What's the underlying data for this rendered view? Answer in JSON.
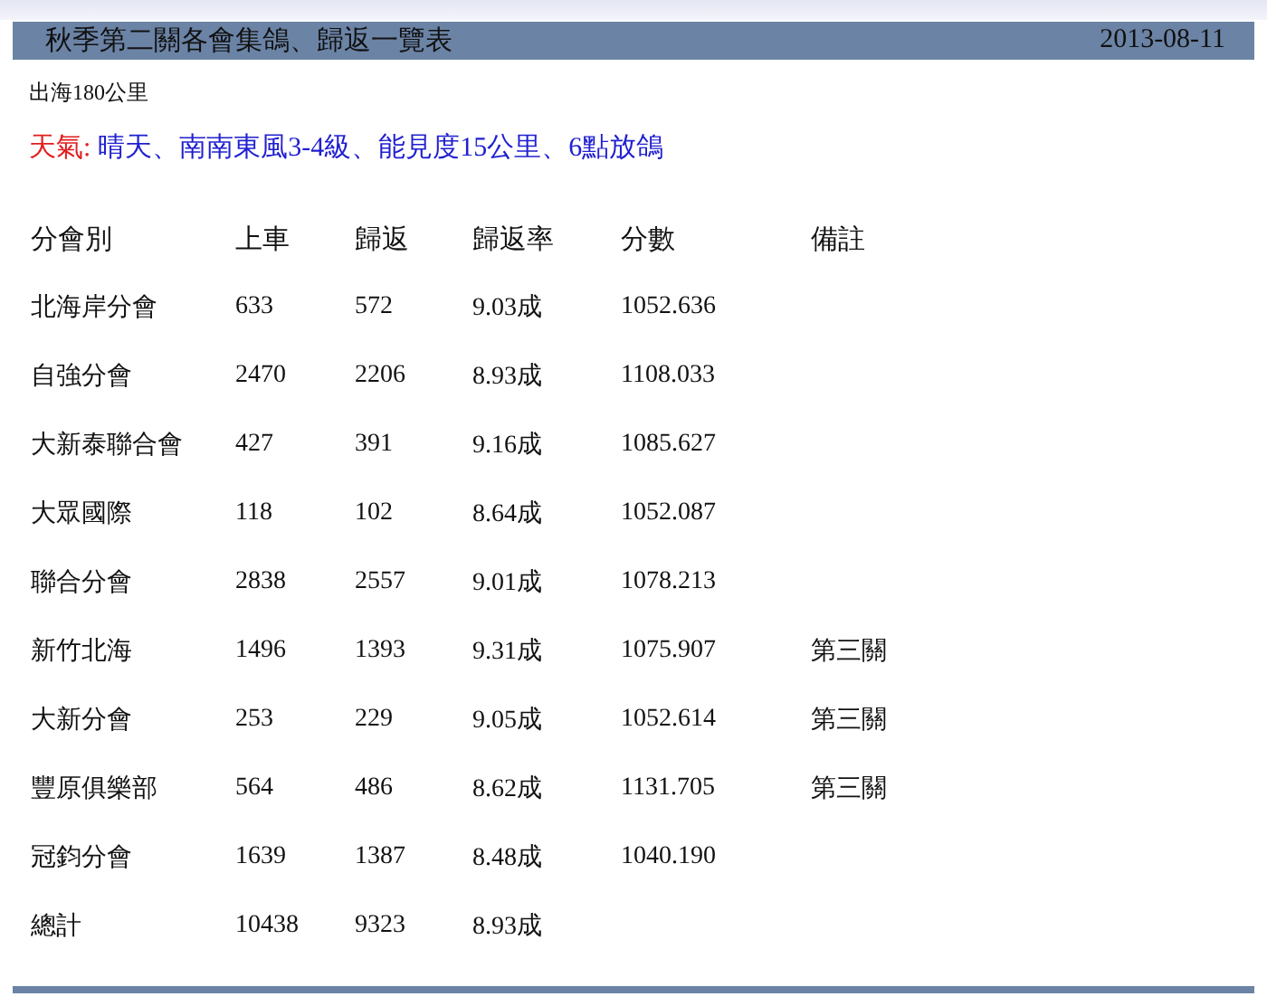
{
  "header": {
    "title": "秋季第二關各會集鴿、歸返一覽表",
    "date": "2013-08-11"
  },
  "distance": "出海180公里",
  "weather": {
    "label": "天氣:",
    "value": "晴天、南南東風3-4級、能見度15公里、6點放鴿"
  },
  "table": {
    "columns": [
      "分會別",
      "上車",
      "歸返",
      "歸返率",
      "分數",
      "備註"
    ],
    "rows": [
      [
        "北海岸分會",
        "633",
        "572",
        "9.03成",
        "1052.636",
        ""
      ],
      [
        "自強分會",
        "2470",
        "2206",
        "8.93成",
        "1108.033",
        ""
      ],
      [
        "大新泰聯合會",
        "427",
        "391",
        "9.16成",
        "1085.627",
        ""
      ],
      [
        "大眾國際",
        "118",
        "102",
        "8.64成",
        "1052.087",
        ""
      ],
      [
        "聯合分會",
        "2838",
        "2557",
        "9.01成",
        "1078.213",
        ""
      ],
      [
        "新竹北海",
        "1496",
        "1393",
        "9.31成",
        "1075.907",
        "第三關"
      ],
      [
        "大新分會",
        "253",
        "229",
        "9.05成",
        "1052.614",
        "第三關"
      ],
      [
        "豐原俱樂部",
        "564",
        "486",
        "8.62成",
        "1131.705",
        "第三關"
      ],
      [
        "冠鈞分會",
        "1639",
        "1387",
        "8.48成",
        "1040.190",
        ""
      ],
      [
        "總計",
        "10438",
        "9323",
        "8.93成",
        "",
        ""
      ]
    ]
  }
}
